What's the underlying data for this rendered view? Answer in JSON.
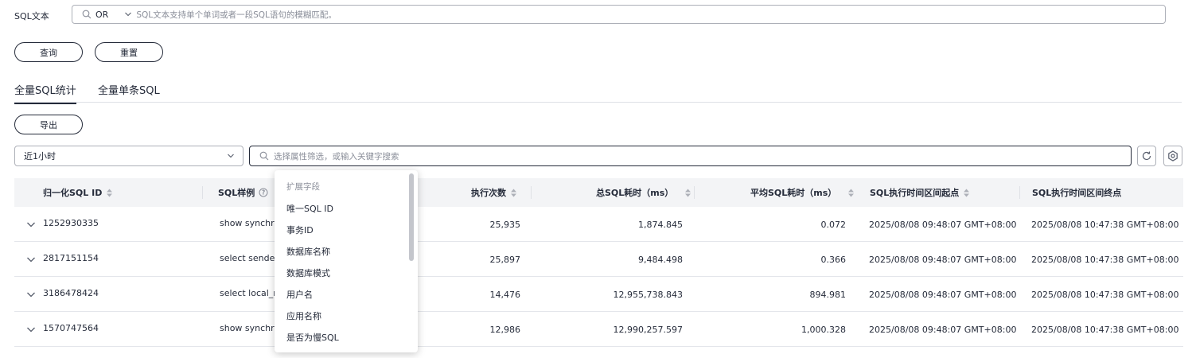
{
  "search": {
    "label": "SQL文本",
    "operator": "OR",
    "placeholder": "SQL文本支持单个单词或者一段SQL语句的模糊匹配。"
  },
  "buttons": {
    "query": "查询",
    "reset": "重置",
    "export": "导出"
  },
  "tabs": [
    "全量SQL统计",
    "全量单条SQL"
  ],
  "time_range": "近1小时",
  "filter_placeholder": "选择属性筛选，或输入关键字搜索",
  "columns": [
    "归一化SQL ID",
    "SQL样例",
    "执行次数",
    "总SQL耗时（ms）",
    "平均SQL耗时（ms）",
    "SQL执行时间区间起点",
    "SQL执行时间区间终点"
  ],
  "rows": [
    {
      "id": "1252930335",
      "sample": "show synchron",
      "count": "25,935",
      "total": "1,874.845",
      "avg": "0.072",
      "start": "2025/08/08 09:48:07 GMT+08:00",
      "end": "2025/08/08 10:47:38 GMT+08:00"
    },
    {
      "id": "2817151154",
      "sample": "select sender_",
      "count": "25,897",
      "total": "9,484.498",
      "avg": "0.366",
      "start": "2025/08/08 09:48:07 GMT+08:00",
      "end": "2025/08/08 10:47:38 GMT+08:00"
    },
    {
      "id": "3186478424",
      "sample": "select local_ro",
      "count": "14,476",
      "total": "12,955,738.843",
      "avg": "894.981",
      "start": "2025/08/08 09:48:07 GMT+08:00",
      "end": "2025/08/08 10:47:38 GMT+08:00"
    },
    {
      "id": "1570747564",
      "sample": "show synchron",
      "count": "12,986",
      "total": "12,990,257.597",
      "avg": "1,000.328",
      "start": "2025/08/08 09:48:07 GMT+08:00",
      "end": "2025/08/08 10:47:38 GMT+08:00"
    }
  ],
  "dropdown": {
    "header": "扩展字段",
    "items": [
      "唯一SQL ID",
      "事务ID",
      "数据库名称",
      "数据库模式",
      "用户名",
      "应用名称",
      "是否为慢SQL"
    ]
  },
  "icons": {
    "search": "search-icon",
    "chevron": "chevron-down-icon",
    "help": "help-circle-icon",
    "sort": "sort-icon",
    "refresh": "refresh-icon",
    "settings": "settings-icon",
    "expand": "expand-chevron-icon"
  }
}
